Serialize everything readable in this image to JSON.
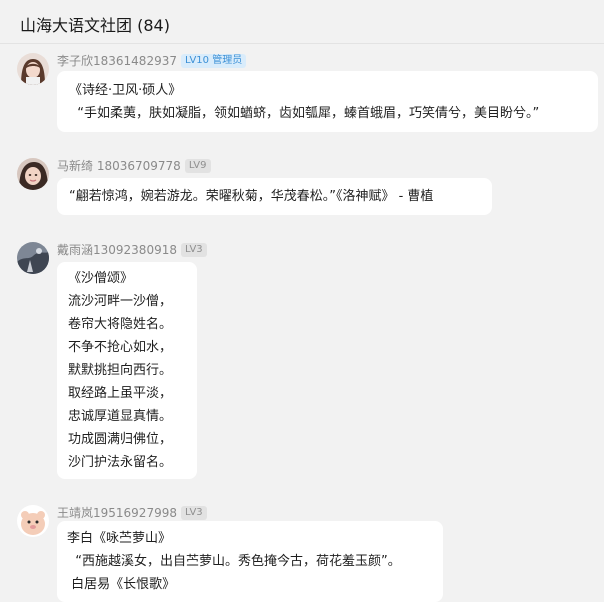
{
  "header": {
    "title": "山海大语文社团 (84)"
  },
  "messages": [
    {
      "sender": "李子欣18361482937",
      "badge": "LV10 管理员",
      "lines": [
        "《诗经·卫风·硕人》",
        "  “手如柔荑，肤如凝脂，领如蝤蛴，齿如瓠犀，螓首蛾眉，巧笑倩兮，美目盼兮。”"
      ]
    },
    {
      "sender": "马新绮 18036709778",
      "badge": "LV9",
      "lines": [
        "“翩若惊鸿，婉若游龙。荣曜秋菊，华茂春松。”《洛神赋》 - 曹植"
      ]
    },
    {
      "sender": "戴雨涵13092380918",
      "badge": "LV3",
      "lines": [
        "《沙僧颂》",
        "流沙河畔一沙僧，",
        "卷帘大将隐姓名。",
        "不争不抢心如水，",
        "默默挑担向西行。",
        "取经路上虽平淡，",
        "忠诚厚道显真情。",
        "功成圆满归佛位，",
        "沙门护法永留名。"
      ]
    },
    {
      "sender": "王靖岚19516927998",
      "badge": "LV3",
      "lines": [
        "李白《咏苎萝山》",
        "  “西施越溪女，出自苎萝山。秀色掩今古，荷花羞玉颜”。",
        " 白居易《长恨歌》"
      ]
    }
  ],
  "colors": {
    "background": "#f2f2f2",
    "bubble": "#ffffff",
    "admin_badge": "#3c90d6",
    "level_badge": "#8f8f8f"
  }
}
